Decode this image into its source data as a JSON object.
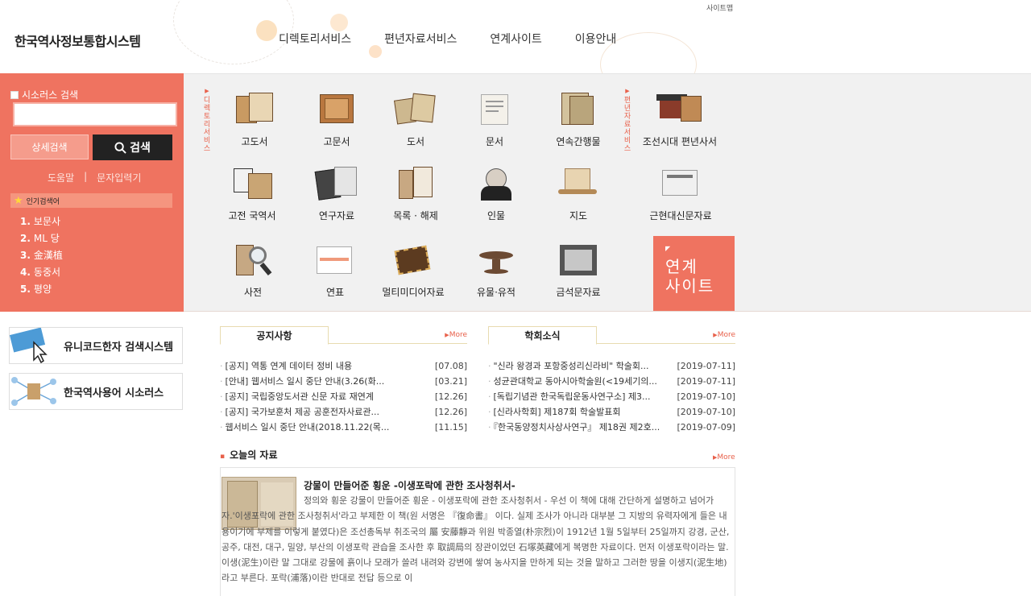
{
  "header": {
    "logo": "한국역사정보통합시스템",
    "sitemap": "사이트맵",
    "nav": [
      "디렉토리서비스",
      "편년자료서비스",
      "연계사이트",
      "이용안내"
    ]
  },
  "search": {
    "thesaurus_label": "시소러스 검색",
    "input_value": "",
    "detail_button": "상세검색",
    "search_button": "검색",
    "help_link": "도움말",
    "separator": "|",
    "char_input_link": "문자입력기"
  },
  "popular": {
    "title": "인기검색어",
    "items": [
      {
        "num": "1.",
        "text": "보문사"
      },
      {
        "num": "2.",
        "text": "ML 당"
      },
      {
        "num": "3.",
        "text": "金漢植"
      },
      {
        "num": "4.",
        "text": "동중서"
      },
      {
        "num": "5.",
        "text": "평양"
      }
    ]
  },
  "directory_label": "디렉토리서비스",
  "chronicle_label": "편년자료서비스",
  "categories": [
    "고도서",
    "고문서",
    "도서",
    "문서",
    "연속간행물",
    "조선시대 편년사서",
    "고전 국역서",
    "연구자료",
    "목록 · 해제",
    "인물",
    "지도",
    "근현대신문자료",
    "사전",
    "연표",
    "멀티미디어자료",
    "유물·유적",
    "금석문자료"
  ],
  "linked_site": {
    "line1": "연계",
    "line2": "사이트"
  },
  "banners": [
    "유니코드한자 검색시스템",
    "한국역사용어 시소러스"
  ],
  "notice": {
    "title": "공지사항",
    "more": "More",
    "rows": [
      {
        "title": "[공지] 역통 연계 데이터 정비 내용",
        "date": "[07.08]"
      },
      {
        "title": "[안내] 웹서비스 일시 중단 안내(3.26(화...",
        "date": "[03.21]"
      },
      {
        "title": "[공지] 국립중앙도서관 신문 자료 재연계",
        "date": "[12.26]"
      },
      {
        "title": "[공지] 국가보훈처 제공 공훈전자사료관...",
        "date": "[12.26]"
      },
      {
        "title": "웹서비스 일시 중단 안내(2018.11.22(목...",
        "date": "[11.15]"
      }
    ]
  },
  "society": {
    "title": "학회소식",
    "more": "More",
    "rows": [
      {
        "title": "\"신라 왕경과 포항중성리신라비\" 학술회...",
        "date": "[2019-07-11]"
      },
      {
        "title": "성균관대학교 동아시아학술원(<19세기의...",
        "date": "[2019-07-11]"
      },
      {
        "title": "[독립기념관 한국독립운동사연구소] 제3...",
        "date": "[2019-07-10]"
      },
      {
        "title": "[신라사학회] 제187회 학술발표회",
        "date": "[2019-07-10]"
      },
      {
        "title": "『한국동양정치사상사연구』 제18권 제2호...",
        "date": "[2019-07-09]"
      }
    ]
  },
  "today": {
    "title": "오늘의 자료",
    "more": "More",
    "item_title": "강물이 만들어준 횡운 -이생포락에 관한 조사청취서-",
    "body": "정의와 횡운 강물이 만들어준 횡운 - 이생포락에 관한 조사청취서 -    우선 이 책에 대해 간단하게 설명하고 넘어가자.'이생포락에 관한 조사청취서'라고 부제한 이 책(원 서명은 『復命書』 이다. 실제 조사가 아니라 대부분 그 지방의 유력자에게 들은 내용이기에 부제를 이렇게 붙였다)은 조선총독부 취조국의 屬 安藤靜과 위원 박종열(朴宗烈)이 1912년 1월 5일부터 25일까지 강경, 군산, 공주, 대전, 대구, 밀양, 부산의 이생포락 관습을 조사한 후 取調局의 장관이었던 石塚英藏에게 복명한 자료이다.    먼저 이생포락이라는 말. 이생(泥生)이란 말 그대로 강물에 흙이나 모래가 쓸려 내려와 강변에 쌓여 농사지을 만하게 되는 것을 말하고 그러한 땅을 이생지(泥生地)라고 부른다. 포락(浦落)이란 반대로 전답 등으로 이"
  },
  "colors": {
    "accent": "#ef7360",
    "band": "#f1f1f1"
  }
}
